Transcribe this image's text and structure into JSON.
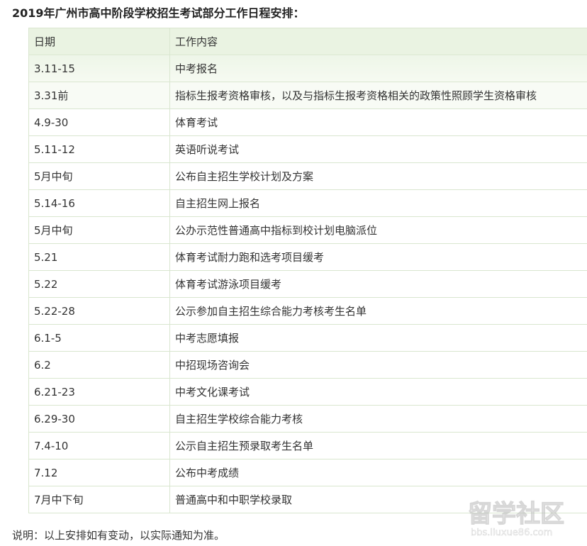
{
  "title": "2019年广州市高中阶段学校招生考试部分工作日程安排：",
  "table": {
    "headers": [
      "日期",
      "工作内容"
    ],
    "rows": [
      [
        "3.11-15",
        "中考报名"
      ],
      [
        "3.31前",
        "指标生报考资格审核，以及与指标生报考资格相关的政策性照顾学生资格审核"
      ],
      [
        "4.9-30",
        "体育考试"
      ],
      [
        "5.11-12",
        "英语听说考试"
      ],
      [
        "5月中旬",
        "公布自主招生学校计划及方案"
      ],
      [
        "5.14-16",
        "自主招生网上报名"
      ],
      [
        "5月中旬",
        "公办示范性普通高中指标到校计划电脑派位"
      ],
      [
        "5.21",
        "体育考试耐力跑和选考项目缓考"
      ],
      [
        "5.22",
        "体育考试游泳项目缓考"
      ],
      [
        "5.22-28",
        "公示参加自主招生综合能力考核考生名单"
      ],
      [
        "6.1-5",
        "中考志愿填报"
      ],
      [
        "6.2",
        "中招现场咨询会"
      ],
      [
        "6.21-23",
        "中考文化课考试"
      ],
      [
        "6.29-30",
        "自主招生学校综合能力考核"
      ],
      [
        "7.4-10",
        "公示自主招生预录取考生名单"
      ],
      [
        "7.12",
        "公布中考成绩"
      ],
      [
        "7月中下旬",
        "普通高中和中职学校录取"
      ]
    ]
  },
  "note": "说明：以上安排如有变动，以实际通知为准。",
  "watermark": {
    "main": "留学社区",
    "url": "bbs.liuxue86.com"
  },
  "colors": {
    "border": "#d9e6cf",
    "header_bg": "#eaf3e2",
    "text": "#333333"
  }
}
